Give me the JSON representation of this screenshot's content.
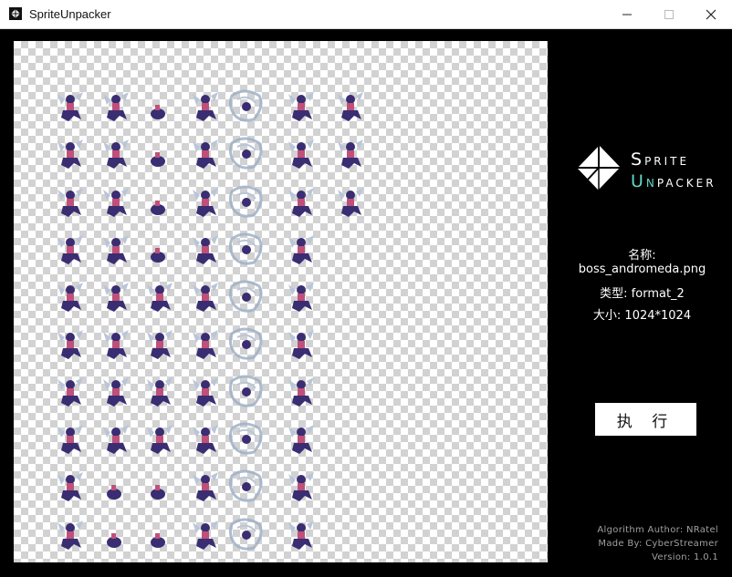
{
  "window": {
    "title": "SpriteUnpacker",
    "icons": {
      "app": "app-logo-icon",
      "minimize": "minimize-icon",
      "maximize": "maximize-icon",
      "close": "close-icon"
    }
  },
  "logo": {
    "line1_first": "S",
    "line1_rest": "PRITE",
    "line2_first": "U",
    "line2_accent": "N",
    "line2_rest": "PACKER",
    "accent_color": "#5fd9c4"
  },
  "info": {
    "name_label": "名称:",
    "name_value": "boss_andromeda.png",
    "type_text": "类型: format_2",
    "size_text": "大小: 1024*1024"
  },
  "actions": {
    "execute_label": "执 行"
  },
  "credits": {
    "author": "Algorithm Author: NRatel",
    "maker": "Made By: CyberStreamer",
    "version": "Version: 1.0.1"
  },
  "sprite_sheet": {
    "row_counts": [
      7,
      7,
      7,
      6,
      6,
      6,
      6,
      6,
      6,
      6
    ],
    "colors": {
      "body": "#3a2d72",
      "accent": "#c0507a",
      "light": "#b9c6d8",
      "fx": "#9fb0c8"
    }
  }
}
